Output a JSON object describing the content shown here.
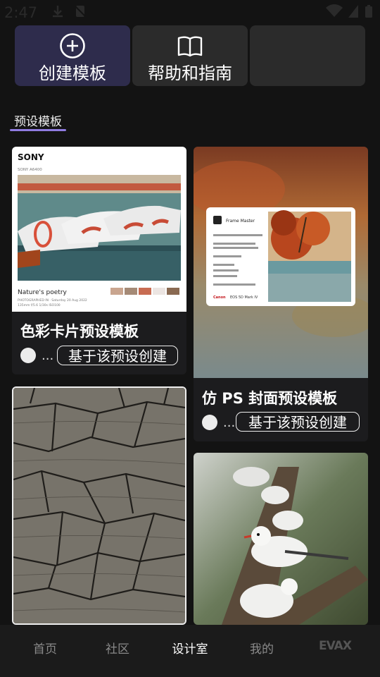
{
  "status_bar": {
    "time": "2:47"
  },
  "actions": [
    {
      "label": "创建模板",
      "icon": "plus-circle-icon"
    },
    {
      "label": "帮助和指南",
      "icon": "book-icon"
    },
    {
      "label": "",
      "icon": ""
    }
  ],
  "section": {
    "tab_label": "预设模板"
  },
  "cards": [
    {
      "title": "色彩卡片预设模板",
      "author_more": "...",
      "button_label": "基于该预设创建",
      "preview": {
        "brand": "SONY",
        "model": "SONY A6400",
        "caption": "Nature's poetry",
        "meta": "PHOTOGRAPHED IN · Saturday 20 Aug 2022",
        "meta2": "135mm   f/5.6   1/30s   ISO100"
      }
    },
    {
      "title": "仿 PS 封面预设模板",
      "author_more": "...",
      "button_label": "基于该预设创建",
      "preview": {
        "app_name": "Frame Master",
        "camera": "EOS 5D Mark IV"
      }
    },
    {
      "title": "",
      "preview": {}
    },
    {
      "title": "",
      "preview": {}
    }
  ],
  "nav": [
    {
      "label": "首页"
    },
    {
      "label": "社区"
    },
    {
      "label": "设计室"
    },
    {
      "label": "我的"
    },
    {
      "label": "EVAX"
    }
  ],
  "colors": {
    "accent": "#8f7be0",
    "primary_button": "#2e2c4c",
    "background": "#131313"
  }
}
